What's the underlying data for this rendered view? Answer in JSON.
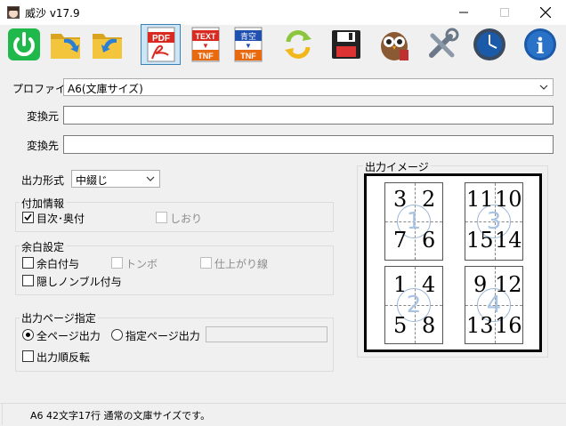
{
  "window": {
    "title": "威沙 v17.9",
    "minimize": "—",
    "maximize": "□",
    "close": "✕"
  },
  "toolbar": {
    "pdf_label": "PDF",
    "text_tnf_top": "TEXT",
    "text_tnf_bottom": "TNF",
    "aozora_tnf_top": "青空",
    "aozora_tnf_bottom": "TNF",
    "info_label": "i",
    "selected_color": "#cde6f7"
  },
  "form": {
    "profile_label": "プロファイル",
    "profile_value": "A6(文庫サイズ)",
    "source_label": "変換元",
    "source_value": "",
    "dest_label": "変換先",
    "dest_value": "",
    "format_label": "出力形式",
    "format_value": "中綴じ"
  },
  "additional_info": {
    "title": "付加情報",
    "toc_label": "目次･奥付",
    "toc_checked": true,
    "bookmark_label": "しおり",
    "bookmark_checked": false
  },
  "margin_settings": {
    "title": "余白設定",
    "margin_label": "余白付与",
    "tombo_label": "トンボ",
    "trim_label": "仕上がり線",
    "hidden_nombre_label": "隠しノンブル付与"
  },
  "output_pages": {
    "title": "出力ページ指定",
    "all_pages_label": "全ページ出力",
    "all_pages_selected": true,
    "specified_label": "指定ページ出力",
    "specified_value": "",
    "reverse_label": "出力順反転"
  },
  "preview": {
    "title": "出力イメージ",
    "sheets": [
      {
        "circle": "1",
        "pages": [
          "3",
          "2",
          "7",
          "6"
        ]
      },
      {
        "circle": "3",
        "pages": [
          "11",
          "10",
          "15",
          "14"
        ]
      },
      {
        "circle": "2",
        "pages": [
          "1",
          "4",
          "5",
          "8"
        ]
      },
      {
        "circle": "4",
        "pages": [
          "9",
          "12",
          "13",
          "16"
        ]
      }
    ]
  },
  "status": {
    "text": "A6 42文字17行 通常の文庫サイズです。"
  }
}
